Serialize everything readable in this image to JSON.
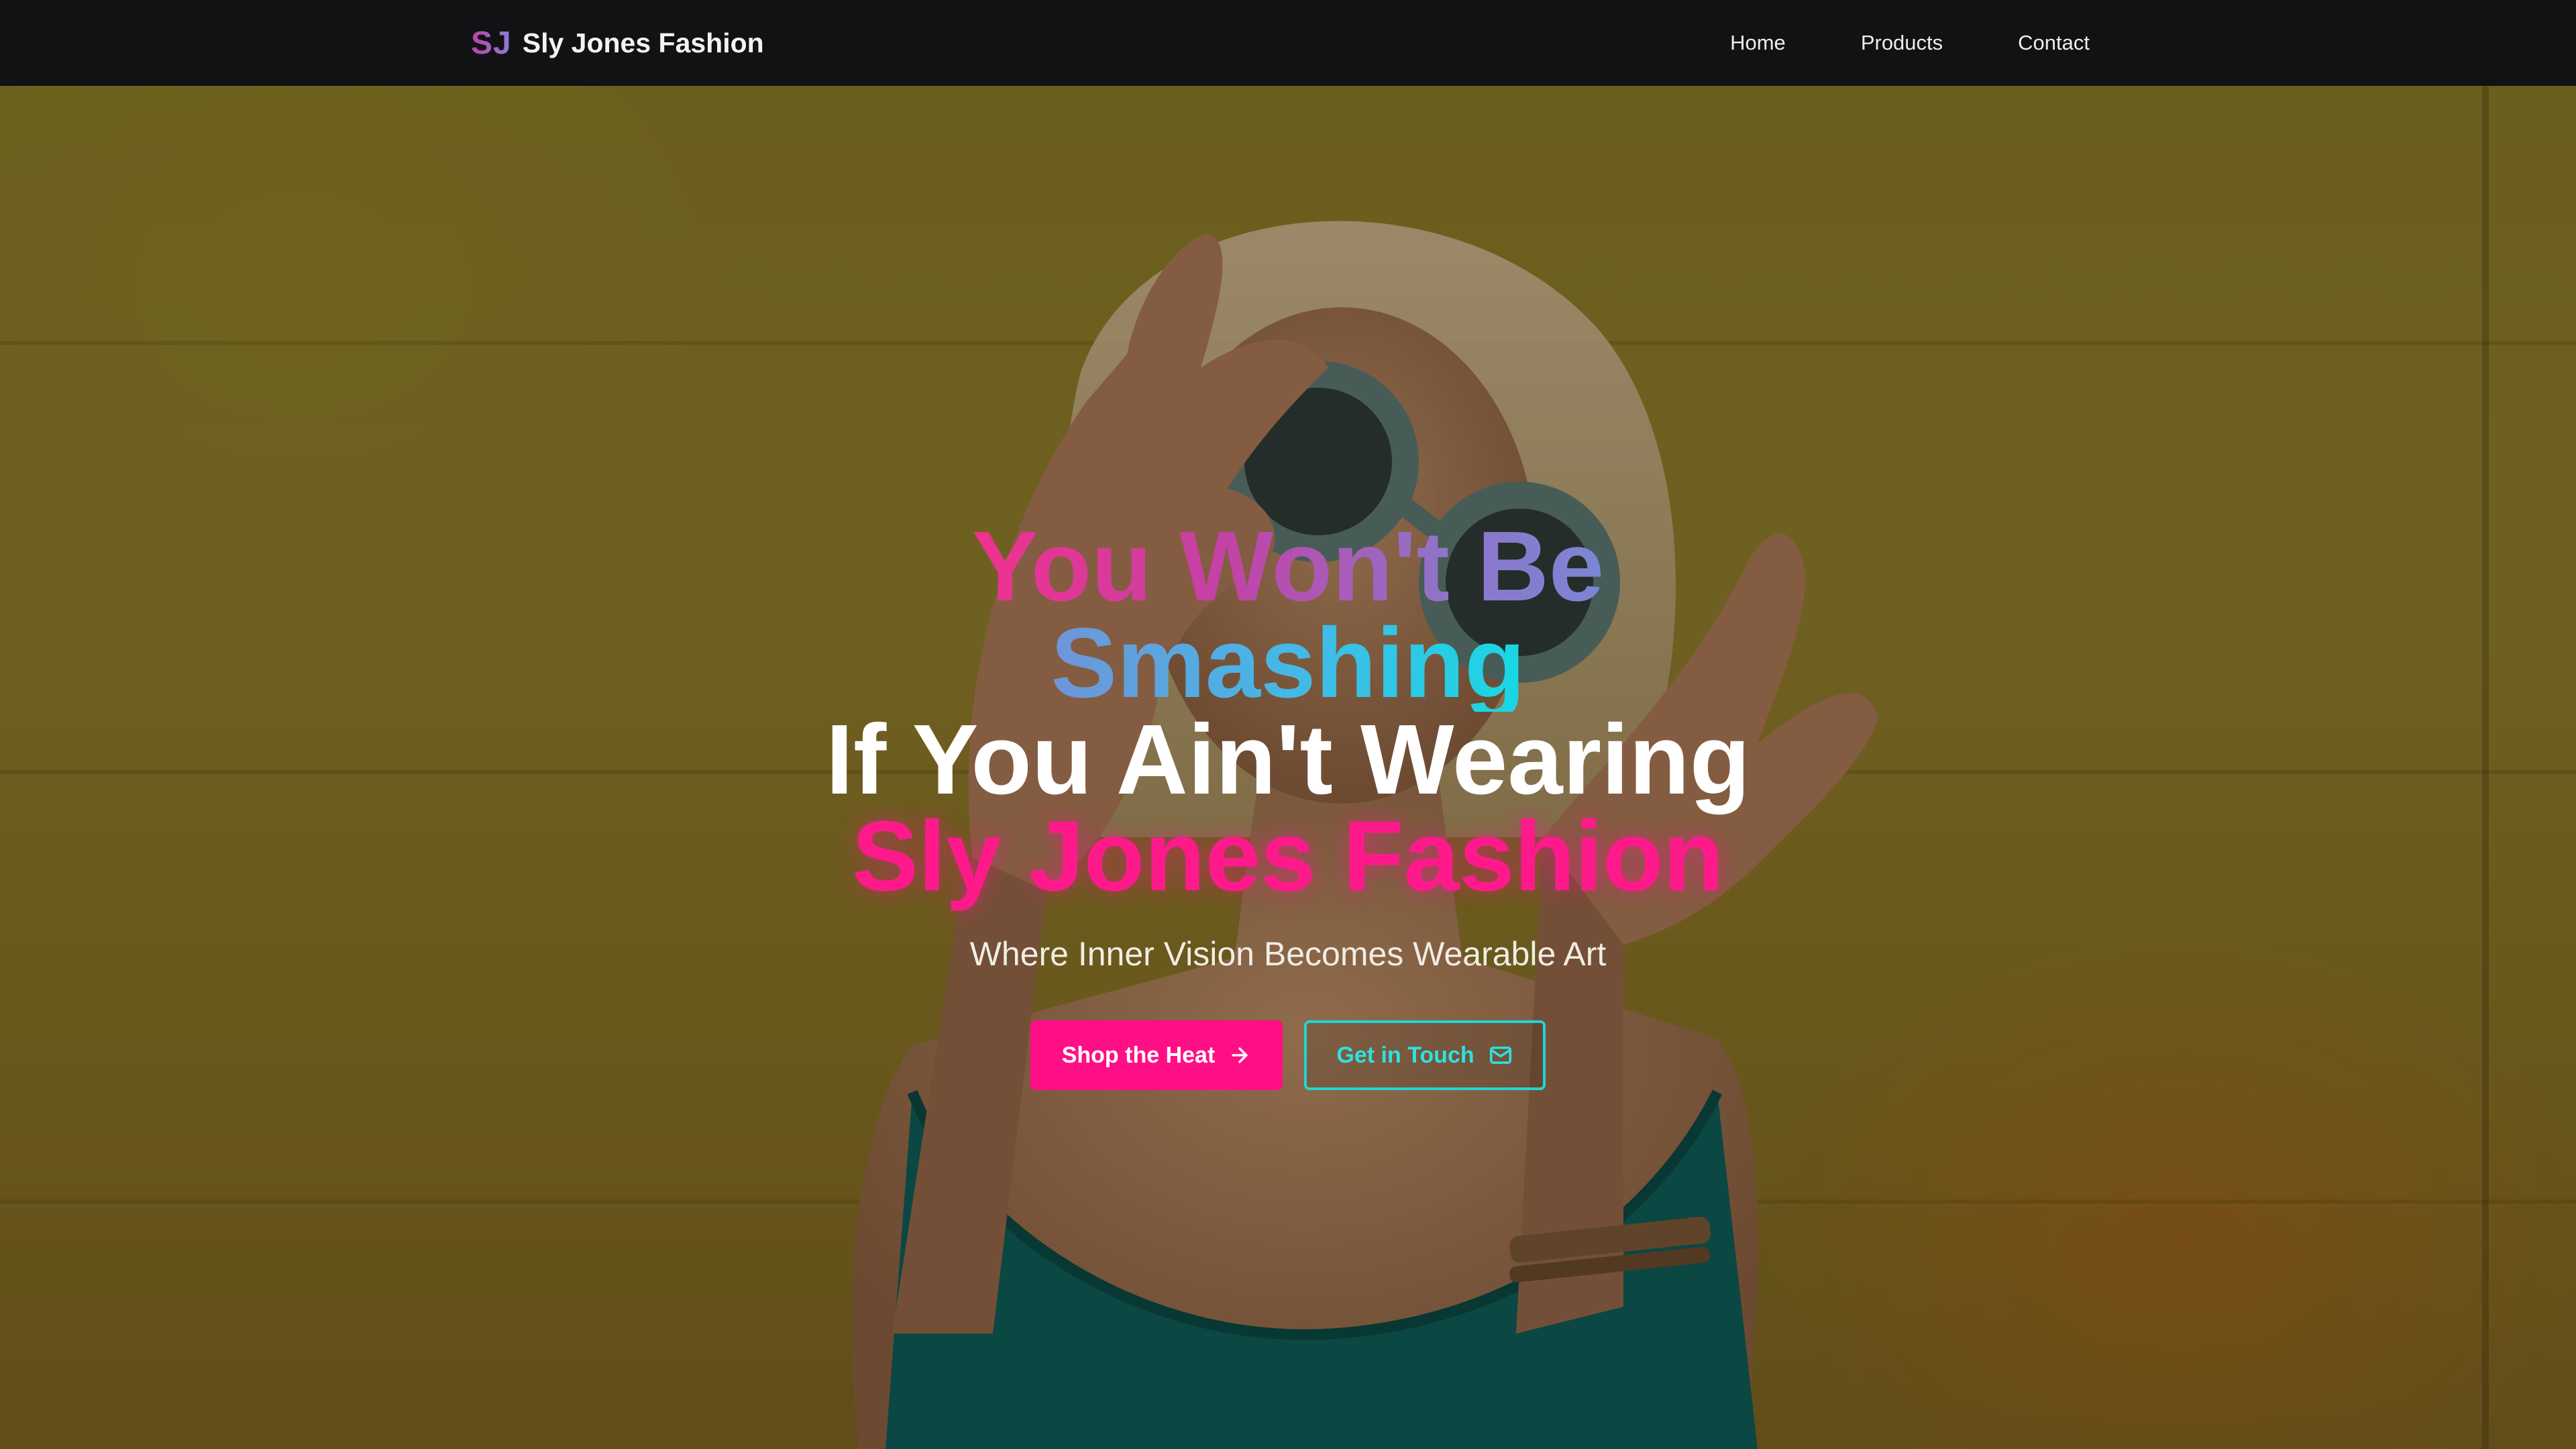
{
  "nav": {
    "brand_mark": "SJ",
    "brand_name": "Sly Jones Fashion",
    "links": [
      "Home",
      "Products",
      "Contact"
    ]
  },
  "hero": {
    "headline": {
      "line1": "You Won't Be",
      "line2": "Smashing",
      "line3": "If You Ain't Wearing",
      "line4": "Sly Jones Fashion"
    },
    "subtitle": "Where Inner Vision Becomes Wearable Art",
    "primary_cta": {
      "label": "Shop the Heat",
      "icon": "arrow-right-icon"
    },
    "secondary_cta": {
      "label": "Get in Touch",
      "icon": "mail-icon"
    }
  },
  "colors": {
    "nav_bg": "#111214",
    "accent_pink": "#ff0f86",
    "accent_cyan": "#1fd6d6",
    "wall_yellow": "#8a7a26"
  }
}
